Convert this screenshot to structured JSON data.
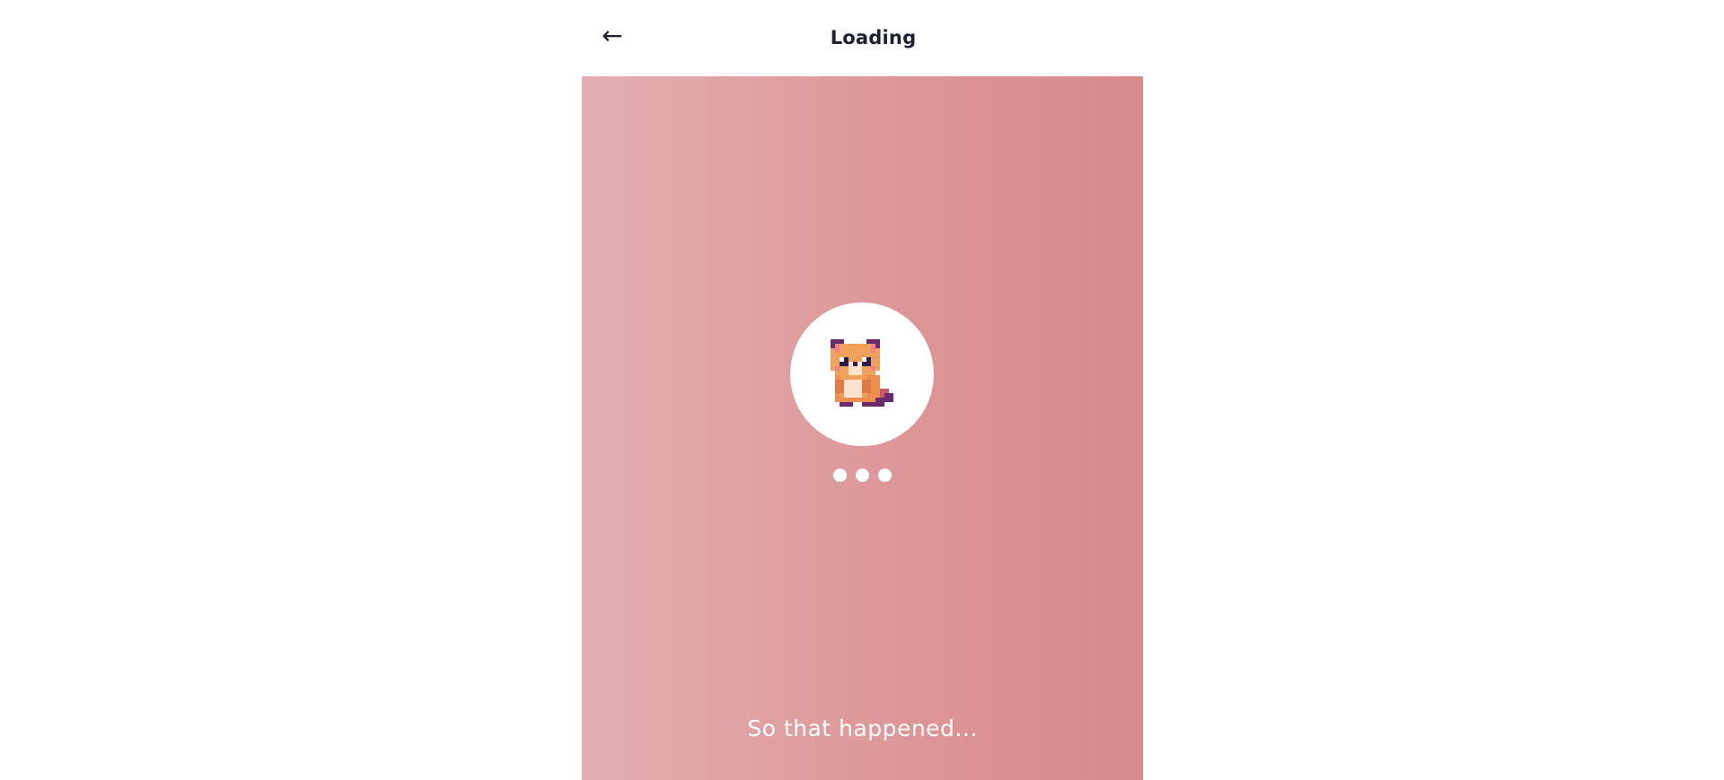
{
  "header": {
    "back_icon": "←",
    "title": "Loading"
  },
  "loading": {
    "mascot_icon": "pixel-bear-cub",
    "indicator_dots": 3,
    "message": "So that happened..."
  },
  "colors": {
    "panel_gradient_start": "#e3aeb0",
    "panel_gradient_end": "#d8898a",
    "title_text": "#1b2132",
    "dot": "#ffffff"
  }
}
